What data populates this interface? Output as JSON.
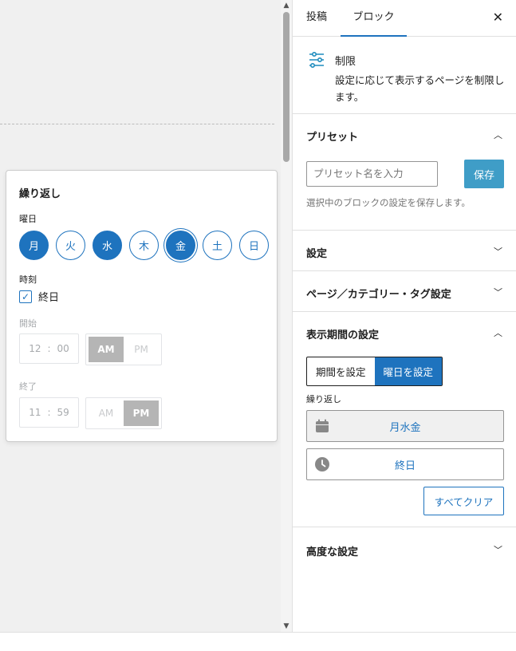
{
  "popover": {
    "title": "繰り返し",
    "weekday_label": "曜日",
    "days": [
      {
        "label": "月",
        "selected": true
      },
      {
        "label": "火",
        "selected": false
      },
      {
        "label": "水",
        "selected": true
      },
      {
        "label": "木",
        "selected": false
      },
      {
        "label": "金",
        "selected": true
      },
      {
        "label": "土",
        "selected": false
      },
      {
        "label": "日",
        "selected": false
      }
    ],
    "time_label": "時刻",
    "all_day_label": "終日",
    "start_label": "開始",
    "start_hour": "12",
    "start_minute": "00",
    "end_label": "終了",
    "end_hour": "11",
    "end_minute": "59",
    "am": "AM",
    "pm": "PM"
  },
  "sidebar": {
    "tabs": [
      "投稿",
      "ブロック"
    ],
    "close_icon": "close-icon",
    "block": {
      "title": "制限",
      "description": "設定に応じて表示するページを制限します。",
      "icon_color": "#1e8cbe"
    },
    "preset": {
      "heading": "プリセット",
      "placeholder": "プリセット名を入力",
      "save_label": "保存",
      "help": "選択中のブロックの設定を保存します。"
    },
    "settings_heading": "設定",
    "page_heading": "ページ／カテゴリー・タグ設定",
    "period": {
      "heading": "表示期間の設定",
      "toggle_period": "期間を設定",
      "toggle_weekday": "曜日を設定",
      "repeat_label": "繰り返し",
      "days_value": "月水金",
      "time_value": "終日",
      "clear_label": "すべてクリア"
    },
    "advanced_heading": "高度な設定"
  },
  "colors": {
    "accent": "#1e73be",
    "save_button": "#1e8cbe"
  }
}
